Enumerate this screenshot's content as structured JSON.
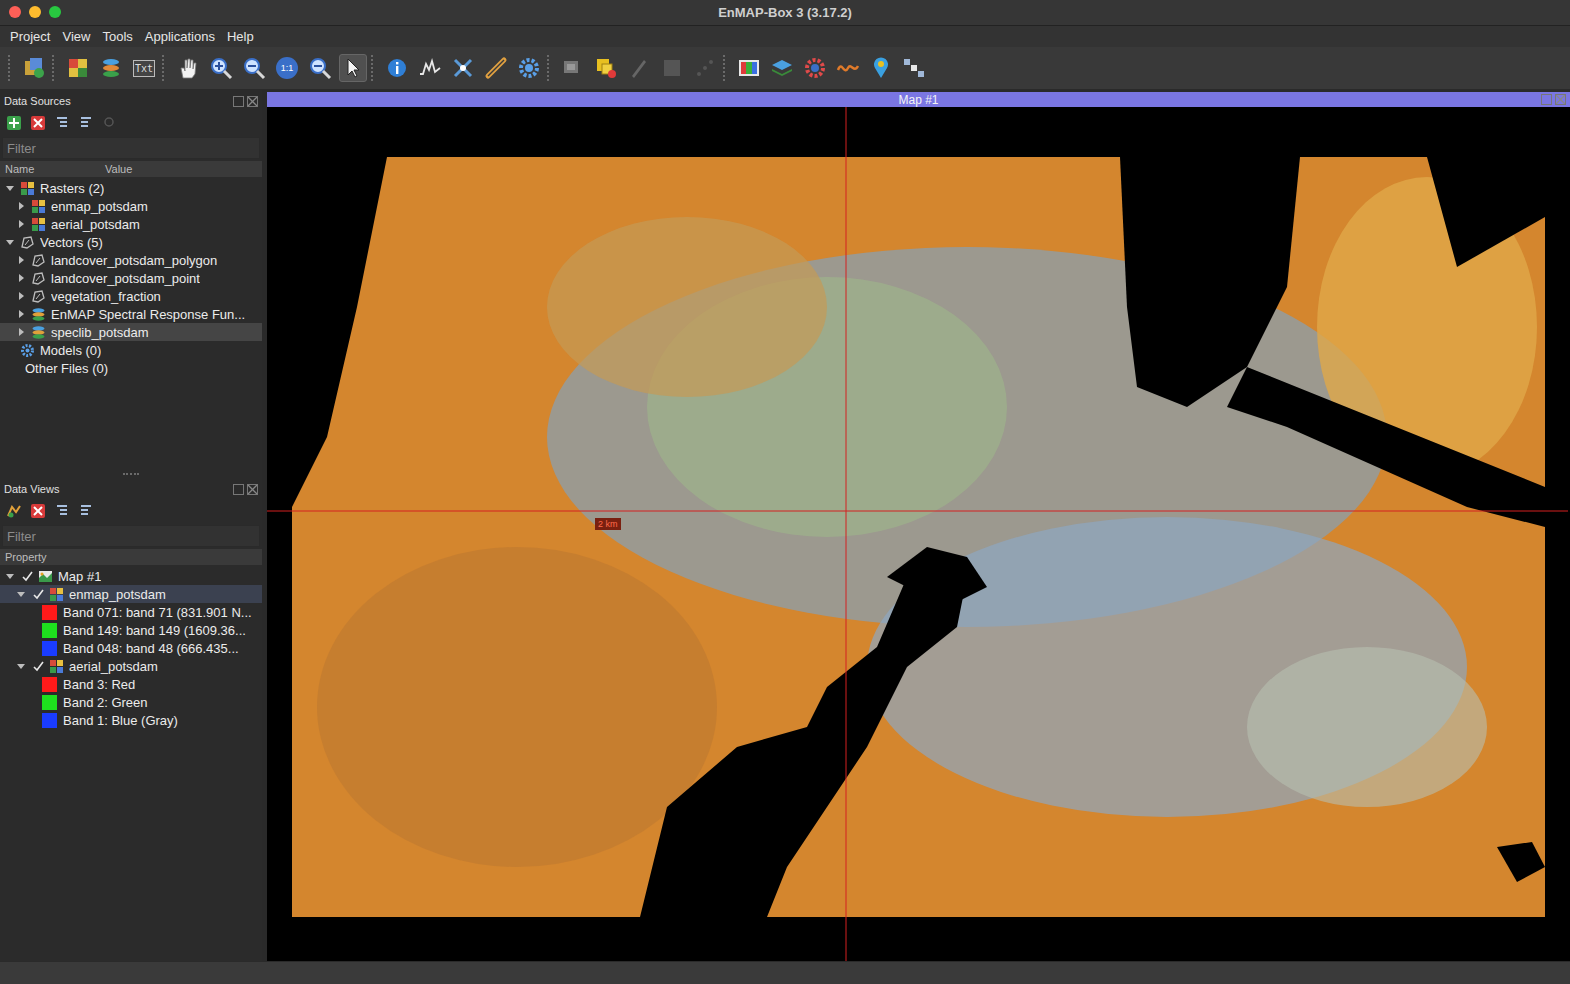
{
  "window": {
    "title": "EnMAP-Box 3 (3.17.2)"
  },
  "menu": [
    "Project",
    "View",
    "Tools",
    "Applications",
    "Help"
  ],
  "toolbar": {
    "text_icon": "Txt",
    "zoom_icon": "1:1"
  },
  "data_sources": {
    "title": "Data Sources",
    "filter": {
      "placeholder": "Filter"
    },
    "columns": [
      "Name",
      "Value"
    ],
    "groups": [
      {
        "label": "Rasters (2)",
        "kind": "raster",
        "expanded": true,
        "items": [
          {
            "label": "enmap_potsdam",
            "kind": "raster",
            "expanded": false,
            "selected": false
          },
          {
            "label": "aerial_potsdam",
            "kind": "raster",
            "expanded": false,
            "selected": false
          }
        ]
      },
      {
        "label": "Vectors (5)",
        "kind": "vector",
        "expanded": true,
        "items": [
          {
            "label": "landcover_potsdam_polygon",
            "kind": "vector",
            "expanded": false,
            "selected": false
          },
          {
            "label": "landcover_potsdam_point",
            "kind": "vector",
            "expanded": false,
            "selected": false
          },
          {
            "label": "vegetation_fraction",
            "kind": "vector",
            "expanded": false,
            "selected": false
          },
          {
            "label": "EnMAP Spectral Response Fun...",
            "kind": "speclib",
            "expanded": false,
            "selected": false
          },
          {
            "label": "speclib_potsdam",
            "kind": "speclib",
            "expanded": false,
            "selected": true
          }
        ]
      },
      {
        "label": "Models (0)",
        "kind": "model",
        "expanded": false,
        "items": []
      },
      {
        "label": "Other Files (0)",
        "kind": "file",
        "expanded": false,
        "items": []
      }
    ]
  },
  "data_views": {
    "title": "Data Views",
    "filter": {
      "placeholder": "Filter"
    },
    "column": "Property",
    "maps": [
      {
        "label": "Map #1",
        "checked": true,
        "expanded": true,
        "layers": [
          {
            "label": "enmap_potsdam",
            "checked": true,
            "expanded": true,
            "selected": true,
            "bands": [
              {
                "label": "Band 071: band 71 (831.901 N...",
                "color": "#ff1a1a"
              },
              {
                "label": "Band 149: band 149 (1609.36...",
                "color": "#1ee01e"
              },
              {
                "label": "Band 048: band 48 (666.435...",
                "color": "#1a3cff"
              }
            ]
          },
          {
            "label": "aerial_potsdam",
            "checked": true,
            "expanded": true,
            "selected": false,
            "bands": [
              {
                "label": "Band 3: Red",
                "color": "#ff1a1a"
              },
              {
                "label": "Band 2: Green",
                "color": "#1ee01e"
              },
              {
                "label": "Band 1: Blue (Gray)",
                "color": "#1a3cff"
              }
            ]
          }
        ]
      }
    ]
  },
  "map": {
    "title": "Map #1",
    "scale": "2 km"
  }
}
